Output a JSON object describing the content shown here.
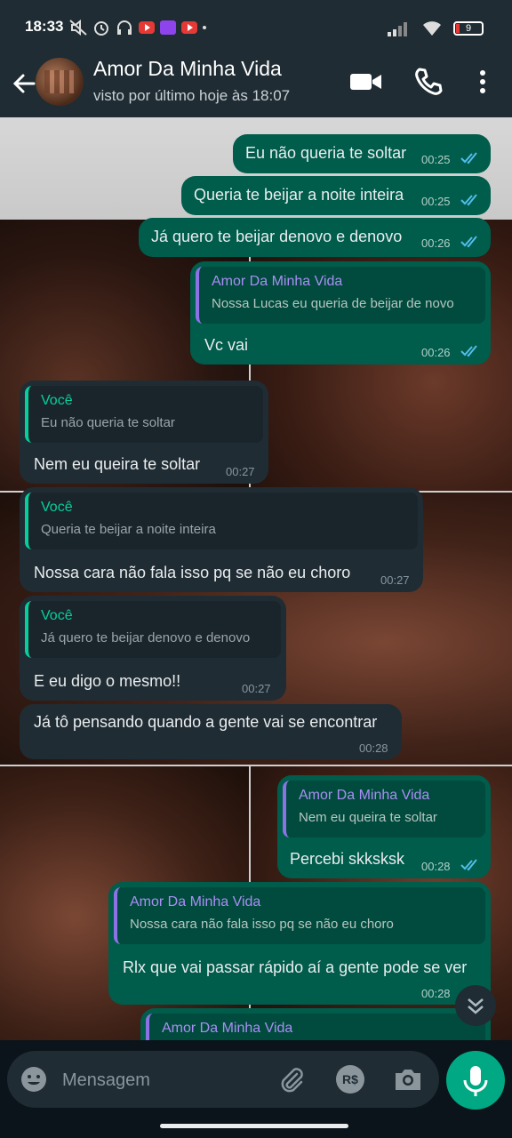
{
  "status_bar": {
    "time": "18:33",
    "battery": "9"
  },
  "header": {
    "contact_name": "Amor Da Minha Vida",
    "last_seen": "visto por último hoje às 18:07"
  },
  "messages": [
    {
      "dir": "out",
      "text": "Eu não queria te soltar",
      "time": "00:25"
    },
    {
      "dir": "out",
      "text": "Queria te beijar a noite inteira",
      "time": "00:25"
    },
    {
      "dir": "out",
      "text": "Já quero te beijar denovo e denovo",
      "time": "00:26"
    },
    {
      "dir": "out",
      "quote_name": "Amor Da Minha Vida",
      "quote_text": "Nossa Lucas eu queria de beijar de novo",
      "text": "Vc vai",
      "time": "00:26"
    },
    {
      "dir": "in",
      "quote_name": "Você",
      "quote_text": "Eu não queria te soltar",
      "text": "Nem eu queira te soltar",
      "time": "00:27"
    },
    {
      "dir": "in",
      "quote_name": "Você",
      "quote_text": "Queria te beijar a noite inteira",
      "text": "Nossa cara não fala isso pq se não eu choro",
      "time": "00:27"
    },
    {
      "dir": "in",
      "quote_name": "Você",
      "quote_text": "Já quero te beijar denovo e denovo",
      "text": "E eu digo o mesmo!!",
      "time": "00:27"
    },
    {
      "dir": "in",
      "text": "Já tô pensando quando a gente vai se encontrar",
      "time": "00:28"
    },
    {
      "dir": "out",
      "quote_name": "Amor Da Minha Vida",
      "quote_text": "Nem eu queira te soltar",
      "text": "Percebi skksksk",
      "time": "00:28"
    },
    {
      "dir": "out",
      "quote_name": "Amor Da Minha Vida",
      "quote_text": "Nossa cara não fala isso pq se não eu choro",
      "text": "Rlx que vai passar rápido aí a gente pode se ver",
      "time": "00:28"
    },
    {
      "dir": "out",
      "quote_name": "Amor Da Minha Vida"
    }
  ],
  "input": {
    "placeholder": "Mensagem",
    "pay_label": "R$"
  },
  "colors": {
    "outgoing": "#005c4b",
    "incoming": "#202c33",
    "accent": "#00a884",
    "read_ticks": "#53bdeb"
  }
}
